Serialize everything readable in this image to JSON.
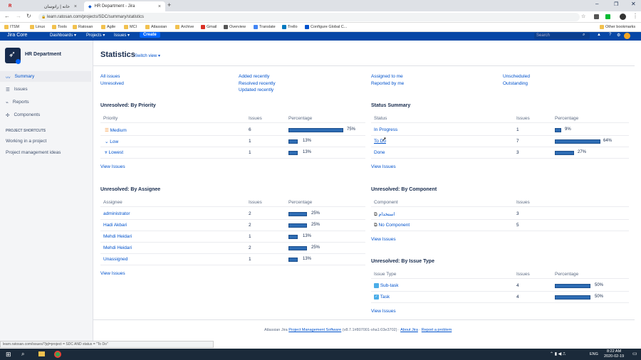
{
  "browser": {
    "tabs": [
      {
        "label": "خانه | راتوسان"
      },
      {
        "label": "HR Department - Jira"
      }
    ],
    "url": "learn.ratosan.com/projects/SDC/summary/statistics",
    "bookmarks": [
      "ITSM",
      "Linux",
      "Tools",
      "Ratosan",
      "Agile",
      "MCI",
      "Atlassian",
      "Archive",
      "Gmail",
      "Overview",
      "Translate",
      "Trello",
      "Configure Global C..."
    ],
    "other_bookmarks": "Other bookmarks"
  },
  "jira_nav": {
    "logo": "Jira Core",
    "menus": [
      "Dashboards",
      "Projects",
      "Issues"
    ],
    "create": "Create",
    "search_placeholder": "Search"
  },
  "sidebar": {
    "project_name": "HR Department",
    "items": [
      {
        "label": "Summary",
        "icon": "pulse-icon"
      },
      {
        "label": "Issues",
        "icon": "list-icon"
      },
      {
        "label": "Reports",
        "icon": "chart-icon"
      },
      {
        "label": "Components",
        "icon": "puzzle-icon"
      }
    ],
    "shortcuts_title": "PROJECT SHORTCUTS",
    "shortcuts": [
      "Working in a project",
      "Project management ideas"
    ]
  },
  "page": {
    "title": "Statistics",
    "switch_view": "Switch view",
    "filters": [
      [
        "All issues",
        "Unresolved"
      ],
      [
        "Added recently",
        "Resolved recently",
        "Updated recently"
      ],
      [
        "Assigned to me",
        "Reported by me"
      ],
      [
        "Unscheduled",
        "Outstanding"
      ]
    ]
  },
  "by_priority": {
    "title": "Unresolved: By Priority",
    "headers": [
      "Priority",
      "Issues",
      "Percentage"
    ],
    "rows": [
      {
        "name": "Medium",
        "issues": "6",
        "pct": "75%",
        "value": 75
      },
      {
        "name": "Low",
        "issues": "1",
        "pct": "13%",
        "value": 13
      },
      {
        "name": "Lowest",
        "issues": "1",
        "pct": "13%",
        "value": 13
      }
    ],
    "view": "View Issues"
  },
  "status_summary": {
    "title": "Status Summary",
    "headers": [
      "Status",
      "Issues",
      "Percentage"
    ],
    "rows": [
      {
        "name": "In Progress",
        "issues": "1",
        "pct": "9%",
        "value": 9
      },
      {
        "name": "To Do",
        "issues": "7",
        "pct": "64%",
        "value": 64
      },
      {
        "name": "Done",
        "issues": "3",
        "pct": "27%",
        "value": 27
      }
    ],
    "view": "View Issues"
  },
  "by_assignee": {
    "title": "Unresolved: By Assignee",
    "headers": [
      "Assignee",
      "Issues",
      "Percentage"
    ],
    "rows": [
      {
        "name": "administrator",
        "issues": "2",
        "pct": "25%",
        "value": 25
      },
      {
        "name": "Hadi Akbari",
        "issues": "2",
        "pct": "25%",
        "value": 25
      },
      {
        "name": "Mehdi Heidari",
        "issues": "1",
        "pct": "13%",
        "value": 13
      },
      {
        "name": "Mehdi Heidari",
        "issues": "2",
        "pct": "25%",
        "value": 25
      },
      {
        "name": "Unassigned",
        "issues": "1",
        "pct": "13%",
        "value": 13
      }
    ],
    "view": "View Issues"
  },
  "by_component": {
    "title": "Unresolved: By Component",
    "headers": [
      "Component",
      "Issues"
    ],
    "rows": [
      {
        "name": "استخدام",
        "issues": "3"
      },
      {
        "name": "No Component",
        "issues": "5"
      }
    ],
    "view": "View Issues"
  },
  "by_issue_type": {
    "title": "Unresolved: By Issue Type",
    "headers": [
      "Issue Type",
      "Issues",
      "Percentage"
    ],
    "rows": [
      {
        "name": "Sub-task",
        "issues": "4",
        "pct": "50%",
        "value": 50
      },
      {
        "name": "Task",
        "issues": "4",
        "pct": "50%",
        "value": 50
      }
    ],
    "view": "View Issues"
  },
  "footer": {
    "text": "Atlassian Jira",
    "link1": "Project Management Software",
    "version": "(v8.7.1#807001-sha1:03e3702)",
    "about": "About Jira",
    "report": "Report a problem"
  },
  "taskbar": {
    "lang": "ENG",
    "time": "8:22 AM",
    "date": "2020-02-19"
  },
  "colors": {
    "accent": "#0052cc",
    "nav": "#0747a6",
    "bar": "#2d6cb4"
  }
}
